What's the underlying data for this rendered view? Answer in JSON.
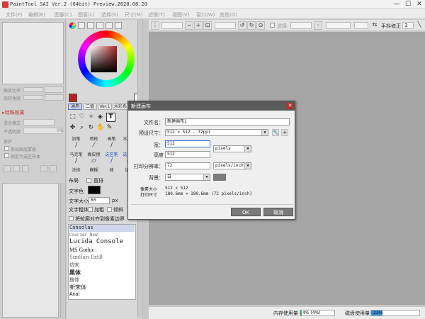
{
  "app": {
    "title": "PaintTool SAI Ver.2 (64bit) Preview.2020.08.20",
    "window_controls": [
      "—",
      "☐",
      "✕"
    ]
  },
  "menu": [
    "文件(F)",
    "编辑(E)",
    "图像(C)",
    "图层(L)",
    "选择(S)",
    "尺寸(M)",
    "滤镜(T)",
    "视图(V)",
    "窗口(W)",
    "其他(O)"
  ],
  "left_panel": {
    "sliders": [
      "缩放比率",
      "旋转角度"
    ],
    "effects_title": "特殊效果",
    "effects": [
      {
        "label": "混合模式"
      },
      {
        "label": "不透明度",
        "value": "0%"
      }
    ],
    "protect_title": "保护",
    "checkboxes": [
      "剪贴图层蒙版",
      "指定为选区样本"
    ]
  },
  "tool_panel": {
    "color_mode_buttons": [
      "wheel",
      "rgb",
      "hsv",
      "palette",
      "swatch",
      "scratch"
    ],
    "tabs": [
      "通用",
      "二值",
      "Ver.1",
      "水彩系"
    ],
    "tool_icons": [
      "selection-icon",
      "lasso-icon",
      "magic-wand-icon",
      "bucket-icon",
      "text-icon"
    ],
    "nav_icons": [
      "move-icon",
      "zoom-icon",
      "rotate-icon",
      "hand-icon",
      "eyedropper-icon"
    ],
    "brushes": [
      [
        "铅笔",
        "喷枪",
        "画笔",
        "水彩笔"
      ],
      [
        "马克笔",
        "橡皮擦",
        "选区笔",
        "选区擦"
      ],
      [
        "涂抹",
        "模糊",
        "抹",
        "填色"
      ]
    ],
    "layout_label": "布局",
    "vertical_label": "直排",
    "text_color_label": "文字色",
    "text_color": "#000000",
    "font_size_label": "文字大小",
    "font_size_value": "60",
    "font_size_unit": "px",
    "style_label": "文字粗体",
    "bold_label": "加粗",
    "italic_label": "倾斜",
    "snap_label": "将轮廓对齐到像素边界",
    "fonts": [
      "Consolas",
      "Courier New",
      "Lucida Console",
      "MS Gothic",
      "SimSun-ExtB",
      "仿宋",
      "黑体",
      "楷体",
      "新宋体",
      "Arial"
    ]
  },
  "toolbar": {
    "selection_label": "选择",
    "stabilizer_label": "手抖修正",
    "stabilizer_value": "3"
  },
  "status": {
    "memory_label": "内存使用量",
    "memory_value": "4% (4%)",
    "memory_fraction": 0.04,
    "disk_label": "磁盘使用量",
    "disk_value": "23%",
    "disk_fraction": 0.23
  },
  "dialog": {
    "title": "新建画布",
    "name_label": "文件名：",
    "name_value": "新建画布1",
    "preset_label": "预设尺寸：",
    "preset_value": "512 × 512 - 72ppi",
    "width_label": "宽：",
    "width_value": "512",
    "height_label": "高度",
    "height_value": "512",
    "size_unit": "pixels",
    "res_label": "打印分辨率：",
    "res_value": "72",
    "res_unit": "pixels/inch",
    "bg_label": "背景：",
    "bg_value": "白",
    "pixel_size_label": "像素大小",
    "pixel_size_value": "512 × 512",
    "print_size_label": "打印尺寸",
    "print_size_value": "180.6mm × 180.6mm (72 pixels/inch)",
    "ok_label": "OK",
    "cancel_label": "取消",
    "bg_swatch": "#7a7a7a"
  }
}
